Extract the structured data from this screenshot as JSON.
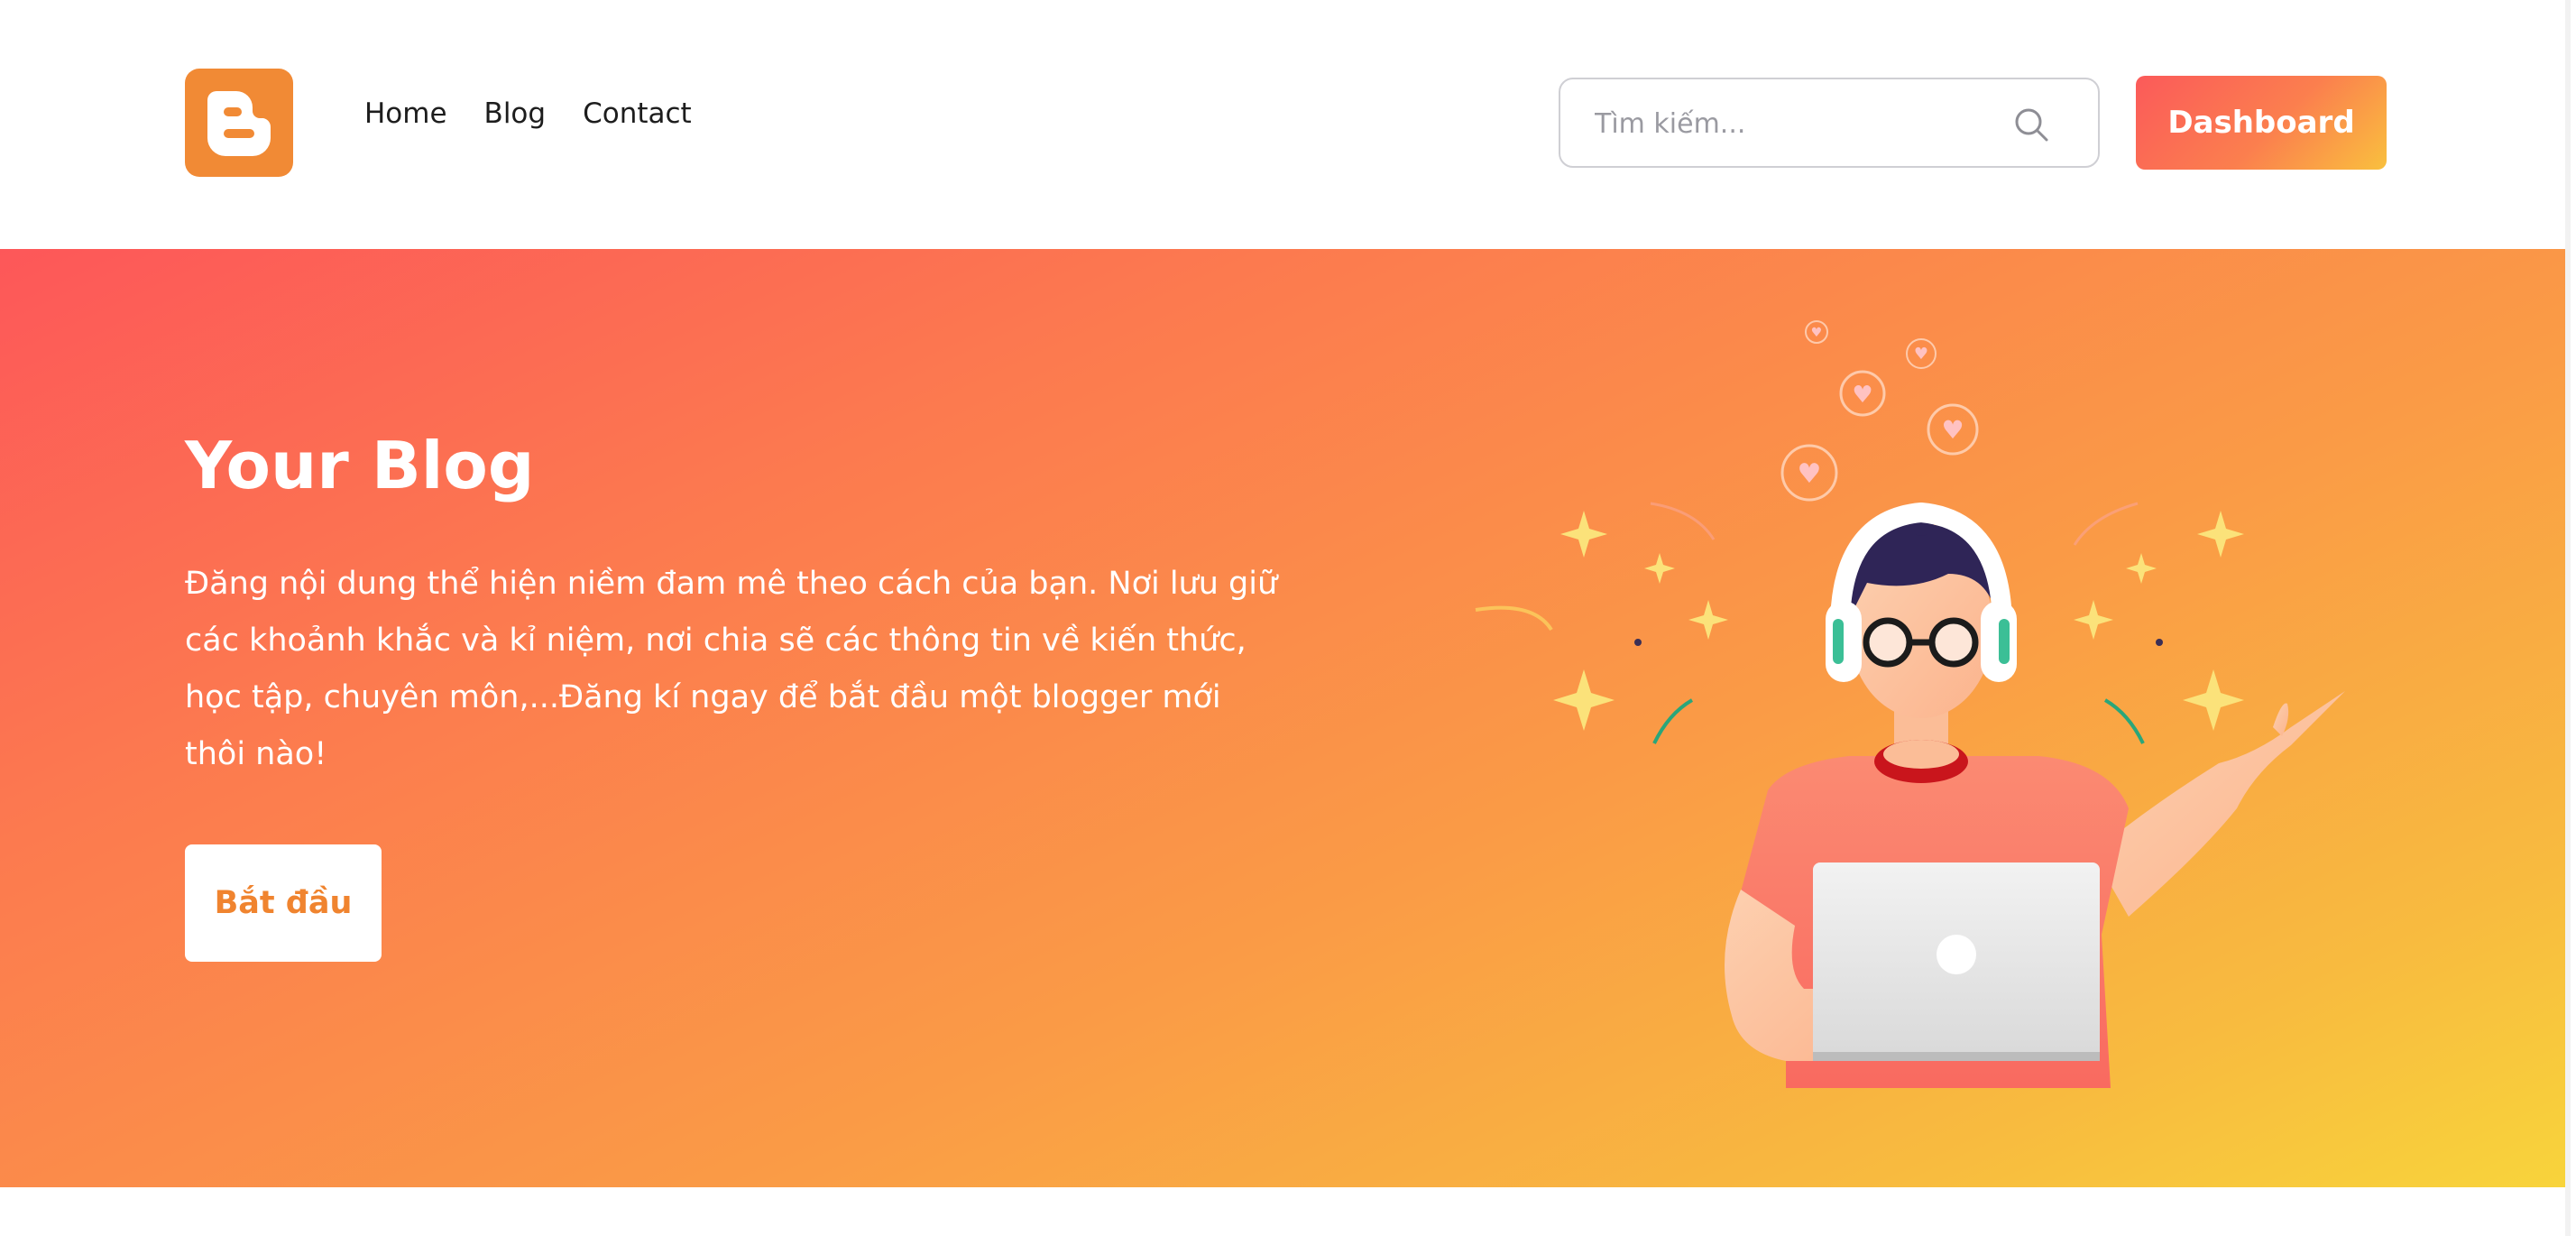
{
  "header": {
    "nav": {
      "home": "Home",
      "blog": "Blog",
      "contact": "Contact"
    },
    "search": {
      "placeholder": "Tìm kiếm..."
    },
    "dashboard_label": "Dashboard"
  },
  "hero": {
    "title": "Your Blog",
    "description": "Đăng nội dung thể hiện niềm đam mê theo cách của bạn. Nơi lưu giữ các khoảnh khắc và kỉ niệm, nơi chia sẽ các thông tin về kiến thức, học tập, chuyên môn,...Đăng kí ngay để bắt đầu một blogger mới thôi nào!",
    "start_label": "Bắt đầu"
  },
  "icons": {
    "logo": "blogger-logo-icon",
    "search": "search-icon",
    "illustration": "blogger-with-laptop-illustration"
  },
  "colors": {
    "brand_orange": "#f18a35",
    "gradient_start": "#fd5759",
    "gradient_end": "#f8d43b",
    "start_button_text": "#f0842f"
  }
}
